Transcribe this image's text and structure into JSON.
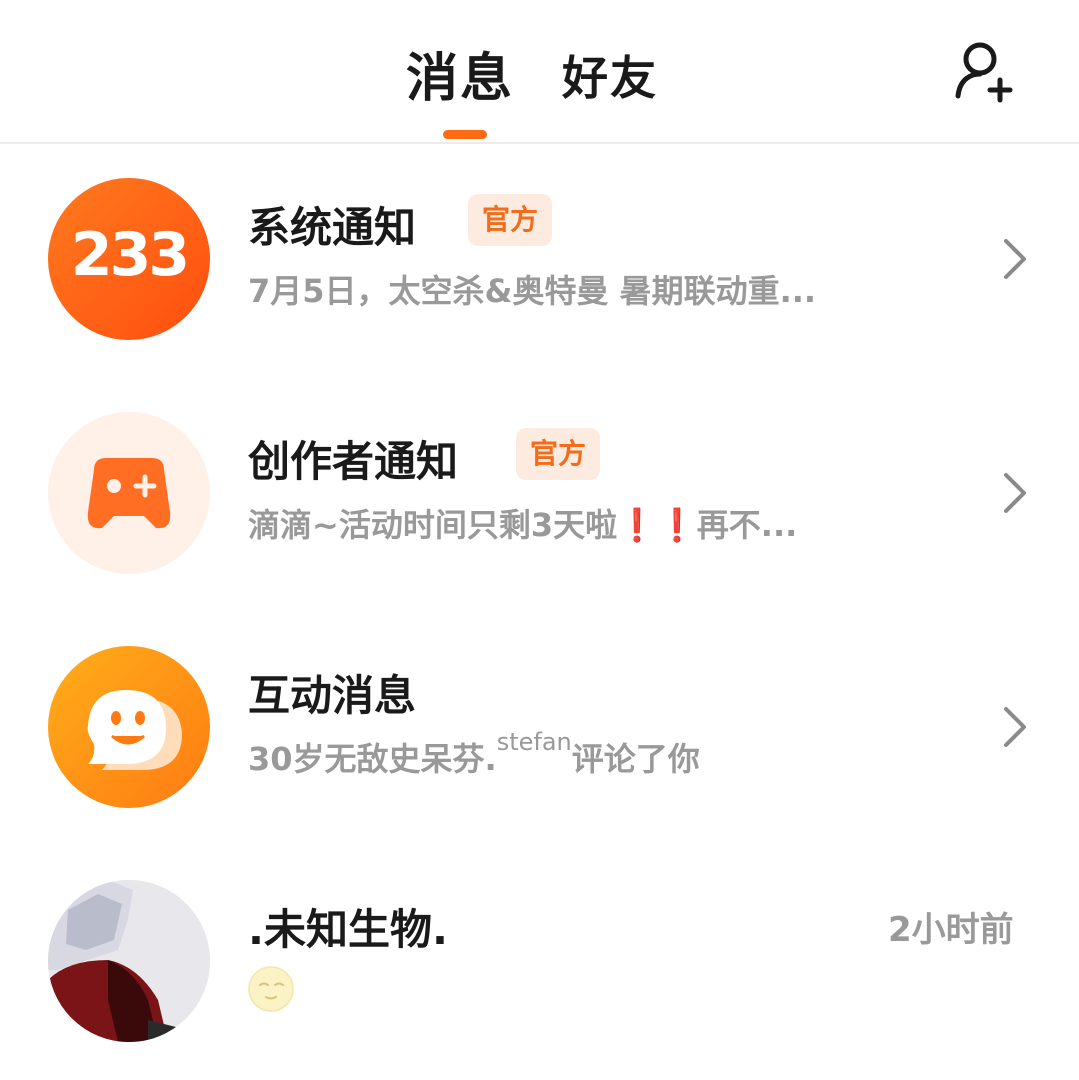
{
  "header": {
    "tabs": [
      {
        "label": "消息"
      },
      {
        "label": "好友"
      }
    ],
    "active_tab_color": "#ff6a13",
    "add_friend_icon": "add-user-icon"
  },
  "rows": [
    {
      "title": "系统通知",
      "badge": "官方",
      "subtitle": "7月5日，太空杀&奥特曼 暑期联动重...",
      "avatar_text": "233",
      "avatar_icon": "brand-logo-233"
    },
    {
      "title": "创作者通知",
      "badge": "官方",
      "subtitle_a": "滴滴~活动时间只剩3天啦",
      "subtitle_excl1": "❗",
      "subtitle_excl2": "❗",
      "subtitle_b": "再不...",
      "avatar_icon": "gamepad-icon"
    },
    {
      "title": "互动消息",
      "subtitle_a": "30岁无敌史呆芬.",
      "subtitle_sup": "stefan",
      "subtitle_b": "评论了你",
      "avatar_icon": "smile-chat-icon"
    },
    {
      "title": ".未知生物.",
      "time": "2小时前",
      "emoji_icon": "moon-face-icon",
      "avatar_icon": "user-avatar"
    }
  ]
}
